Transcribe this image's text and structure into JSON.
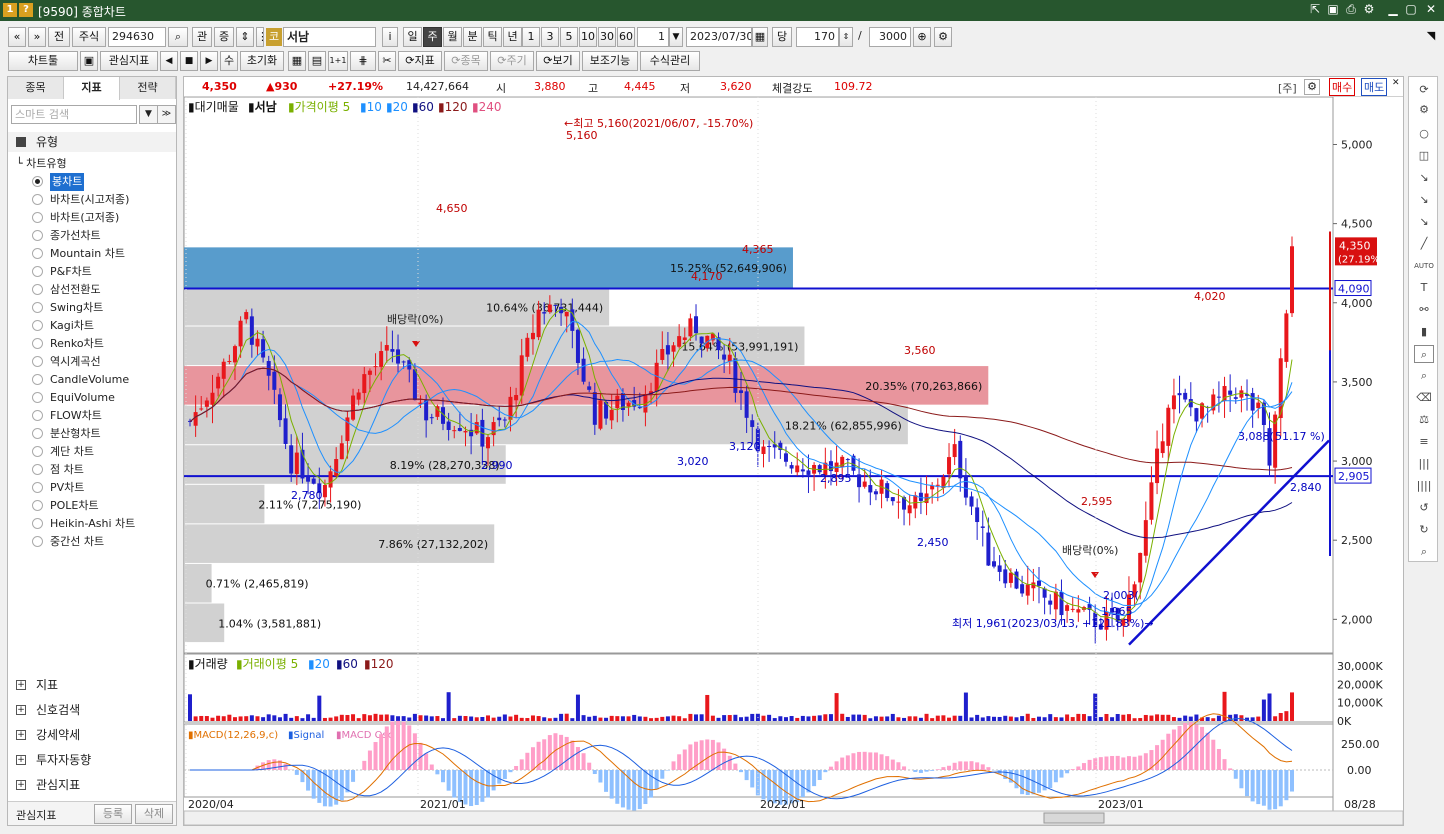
{
  "window": {
    "icon1": "1",
    "icon2": "?",
    "title": "[9590] 종합차트"
  },
  "toolbar1": {
    "market": "주식",
    "code": "294630",
    "관": "관",
    "증": "증",
    "gu": "코",
    "name": "서남",
    "info": "i",
    "periods": [
      "일",
      "주",
      "월",
      "분",
      "틱",
      "년"
    ],
    "active_period": "주",
    "minutes": [
      "1",
      "3",
      "5",
      "10",
      "30",
      "60"
    ],
    "interval": "1",
    "date": "2023/07/30",
    "dang": "당",
    "count": "170",
    "slash": "/",
    "total": "3000",
    "prev": "«",
    "prev2": "»",
    "jeon": "전"
  },
  "toolbar2": {
    "chart_tools": "차트툴",
    "watch_indicator": "관심지표",
    "su": "수",
    "reset": "초기화",
    "one_plus": "1+1",
    "indicator": "지표",
    "stock": "종목",
    "period": "주기",
    "view": "보기",
    "aux": "보조기능",
    "formula": "수식관리"
  },
  "sidebar": {
    "tabs": [
      "종목",
      "지표",
      "전략"
    ],
    "active_tab": "지표",
    "search_placeholder": "스마트 검색",
    "section": "유형",
    "tree_label": "차트유형",
    "items": [
      "봉차트",
      "바차트(시고저종)",
      "바차트(고저종)",
      "종가선차트",
      "Mountain 차트",
      "P&F차트",
      "삼선전환도",
      "Swing차트",
      "Kagi차트",
      "Renko차트",
      "역시계곡선",
      "CandleVolume",
      "EquiVolume",
      "FLOW차트",
      "분산형차트",
      "계단 차트",
      "점 차트",
      "PV차트",
      "POLE차트",
      "Heikin-Ashi 차트",
      "중간선 차트"
    ],
    "selected": "봉차트",
    "footer": [
      "지표",
      "신호검색",
      "강세약세",
      "투자자동향",
      "관심지표"
    ],
    "bottom_label": "관심지표",
    "register": "등록",
    "delete": "삭제"
  },
  "infobar": {
    "price": "4,350",
    "change": "▲930",
    "pct": "+27.19%",
    "volume": "14,427,664",
    "open_label": "시",
    "open": "3,880",
    "high_label": "고",
    "high": "4,445",
    "low_label": "저",
    "low": "3,620",
    "strength_label": "체결강도",
    "strength": "109.72",
    "ju": "[주]",
    "buy": "매수",
    "sell": "매도"
  },
  "legend": {
    "main": "대기매물",
    "name": "서남",
    "ma_label": "가격이평",
    "ma": [
      "5",
      "10",
      "20",
      "60",
      "120",
      "240"
    ],
    "vol_label": "거래량",
    "vol_ma_label": "거래이평",
    "vol_ma": [
      "5",
      "20",
      "60",
      "120"
    ],
    "macd": "MACD(12,26,9,c)",
    "signal": "Signal",
    "osc": "MACD Osc"
  },
  "chart_data": {
    "type": "candlestick",
    "title": "",
    "ylim": [
      1800,
      5300
    ],
    "y_ticks": [
      "5,000",
      "4,500",
      "4,000",
      "3,500",
      "3,000",
      "2,500",
      "2,000"
    ],
    "x_ticks": [
      "2020/04",
      "2021/01",
      "2022/01",
      "2023/01",
      "08/28"
    ],
    "current_price_tag": "4,350",
    "current_pct_tag": "(27.19%)",
    "hline_tags": [
      "4,090",
      "2,905"
    ],
    "profile": [
      {
        "price_low": 4090,
        "price_high": 4350,
        "label": "15.25% (52,649,906)",
        "color": "#4691c6",
        "length": 0.53
      },
      {
        "price_low": 3850,
        "price_high": 4090,
        "label": "10.64% (36,731,444)",
        "color": "#cccccc",
        "length": 0.37
      },
      {
        "price_low": 3600,
        "price_high": 3850,
        "label": "15.64% (53,991,191)",
        "color": "#cccccc",
        "length": 0.54
      },
      {
        "price_low": 3350,
        "price_high": 3600,
        "label": "20.35% (70,263,866)",
        "color": "#e58a92",
        "length": 0.7
      },
      {
        "price_low": 3100,
        "price_high": 3350,
        "label": "18.21% (62,855,996)",
        "color": "#cccccc",
        "length": 0.63
      },
      {
        "price_low": 2850,
        "price_high": 3100,
        "label": "8.19% (28,270,338)",
        "color": "#cccccc",
        "length": 0.28
      },
      {
        "price_low": 2600,
        "price_high": 2850,
        "label": "2.11% (7,275,190)",
        "color": "#cccccc",
        "length": 0.07
      },
      {
        "price_low": 2350,
        "price_high": 2600,
        "label": "7.86% (27,132,202)",
        "color": "#cccccc",
        "length": 0.27
      },
      {
        "price_low": 2100,
        "price_high": 2350,
        "label": "0.71% (2,465,819)",
        "color": "#cccccc",
        "length": 0.024
      },
      {
        "price_low": 1850,
        "price_high": 2100,
        "label": "1.04% (3,581,881)",
        "color": "#cccccc",
        "length": 0.035
      }
    ],
    "annotations": [
      {
        "text": "←최고 5,160(2021/06/07, -15.70%)",
        "color": "#c00000"
      },
      {
        "text": "5,160",
        "color": "#c00000"
      },
      {
        "text": "4,650",
        "color": "#c00000"
      },
      {
        "text": "4,365",
        "color": "#c00000"
      },
      {
        "text": "4,170",
        "color": "#c00000"
      },
      {
        "text": "4,020",
        "color": "#c00000"
      },
      {
        "text": "3,560",
        "color": "#c00000"
      },
      {
        "text": "2,595",
        "color": "#c00000"
      },
      {
        "text": "2,780",
        "color": "#0000c0"
      },
      {
        "text": "2,990",
        "color": "#0000c0"
      },
      {
        "text": "3,020",
        "color": "#0000c0"
      },
      {
        "text": "3,120",
        "color": "#0000c0"
      },
      {
        "text": "2,895",
        "color": "#0000c0"
      },
      {
        "text": "2,450",
        "color": "#0000c0"
      },
      {
        "text": "1,965",
        "color": "#0000c0"
      },
      {
        "text": "2,840",
        "color": "#0000c0"
      },
      {
        "text": "2,003(",
        "color": "#0000c0"
      },
      {
        "text": "3,088(",
        "color": "#0000c0"
      },
      {
        "text": "51.17 %)",
        "color": "#0000c0"
      },
      {
        "text": "최저 1,961(2023/03/13, +121.83%)→",
        "color": "#0000c0"
      },
      {
        "text": "배당락(0%)",
        "color": "#222222"
      },
      {
        "text": "배당락(0%)",
        "color": "#222222"
      }
    ],
    "volume": {
      "ylim": [
        0,
        35000
      ],
      "y_ticks": [
        "30,000K",
        "20,000K",
        "10,000K",
        "0K"
      ]
    },
    "macd": {
      "y_ticks": [
        "250.00",
        "0.00"
      ]
    }
  },
  "colors": {
    "up": "#e8171c",
    "down": "#1f1fcc",
    "title_bg": "#27562e"
  }
}
